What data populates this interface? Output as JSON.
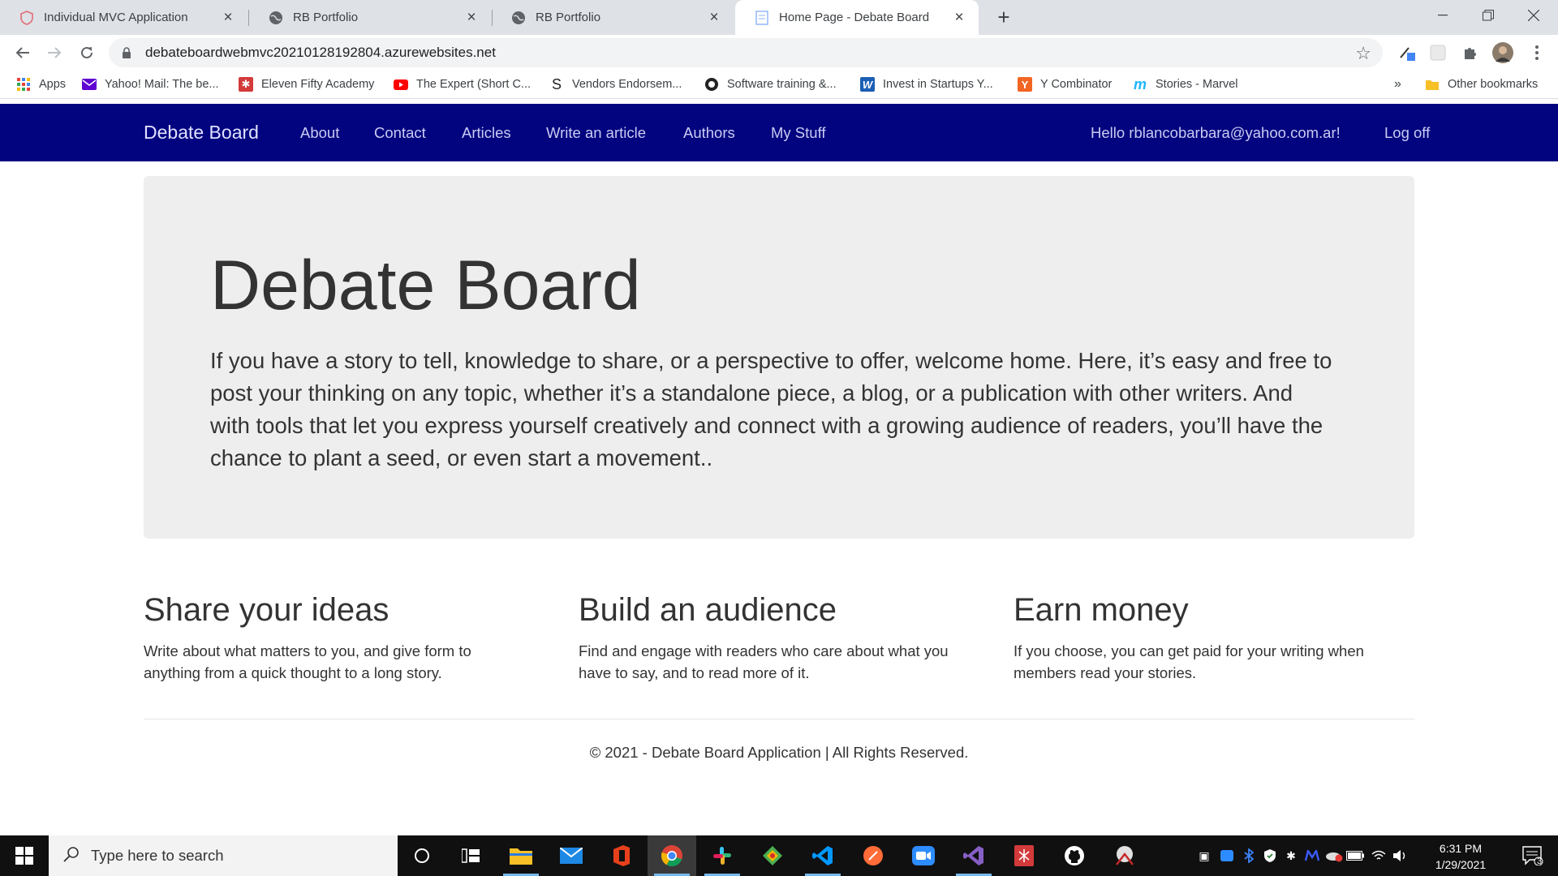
{
  "browser": {
    "tabs": [
      {
        "title": "Individual MVC Application",
        "active": false
      },
      {
        "title": "RB Portfolio",
        "active": false
      },
      {
        "title": "RB Portfolio",
        "active": false
      },
      {
        "title": "Home Page - Debate Board",
        "active": true
      }
    ],
    "url": "debateboardwebmvc20210128192804.azurewebsites.net",
    "bookmarks": [
      {
        "label": "Apps",
        "icon": "apps-grid-icon"
      },
      {
        "label": "Yahoo! Mail: The be...",
        "icon": "yahoo-mail-icon"
      },
      {
        "label": "Eleven Fifty Academy",
        "icon": "eleven-fifty-icon"
      },
      {
        "label": "The Expert (Short C...",
        "icon": "youtube-icon"
      },
      {
        "label": "Vendors Endorsem...",
        "icon": "s-logo-icon"
      },
      {
        "label": "Software training &...",
        "icon": "globe-icon"
      },
      {
        "label": "Invest in Startups Y...",
        "icon": "w-logo-icon"
      },
      {
        "label": "Y Combinator",
        "icon": "y-combinator-icon"
      },
      {
        "label": "Stories - Marvel",
        "icon": "marvel-icon"
      }
    ],
    "more_bookmarks": "»",
    "other_bookmarks": "Other bookmarks"
  },
  "site": {
    "brand": "Debate Board",
    "nav": [
      "About",
      "Contact",
      "Articles",
      "Write an article",
      "Authors",
      "My Stuff"
    ],
    "greeting": "Hello rblancobarbara@yahoo.com.ar!",
    "logoff": "Log off",
    "colors": {
      "navbar": "#02037f",
      "jumbotron": "#eeeeee"
    }
  },
  "hero": {
    "title": "Debate Board",
    "text": "If you have a story to tell, knowledge to share, or a perspective to offer, welcome home. Here, it’s easy and free to post your thinking on any topic, whether it’s a standalone piece, a blog, or a publication with other writers. And with tools that let you express yourself creatively and connect with a growing audience of readers, you’ll have the chance to plant a seed, or even start a movement.."
  },
  "features": [
    {
      "title": "Share your ideas",
      "text": "Write about what matters to you, and give form to anything from a quick thought to a long story."
    },
    {
      "title": "Build an audience",
      "text": "Find and engage with readers who care about what you have to say, and to read more of it."
    },
    {
      "title": "Earn money",
      "text": "If you choose, you can get paid for your writing when members read your stories."
    }
  ],
  "footer": "© 2021 - Debate Board Application | All Rights Reserved.",
  "taskbar": {
    "search_placeholder": "Type here to search",
    "time": "6:31 PM",
    "date": "1/29/2021",
    "notification_count": "3"
  }
}
